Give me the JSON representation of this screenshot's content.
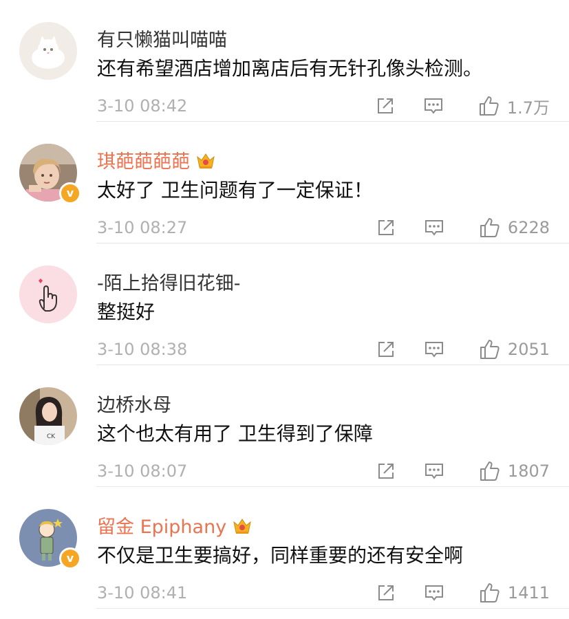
{
  "colors": {
    "vip_name": "#eb7350",
    "normal_name": "#333333",
    "time": "#b0b0b0",
    "verify_badge": "#f5a623"
  },
  "comments": [
    {
      "username": "有只懒猫叫喵喵",
      "vip": false,
      "verified": false,
      "text": "还有希望酒店增加离店后有无针孔像头检测。",
      "time": "3-10 08:42",
      "likes": "1.7万",
      "avatar_icon": "white-kitten-avatar"
    },
    {
      "username": "琪葩葩葩葩",
      "vip": true,
      "verified": true,
      "text": "太好了 卫生问题有了一定保证！",
      "time": "3-10 08:27",
      "likes": "6228",
      "avatar_icon": "child-photo-avatar"
    },
    {
      "username": "-陌上拾得旧花钿-",
      "vip": false,
      "verified": false,
      "text": "整挺好",
      "time": "3-10 08:38",
      "likes": "2051",
      "avatar_icon": "finger-heart-avatar"
    },
    {
      "username": "边桥水母",
      "vip": false,
      "verified": false,
      "text": "这个也太有用了 卫生得到了保障",
      "time": "3-10 08:07",
      "likes": "1807",
      "avatar_icon": "girl-photo-avatar"
    },
    {
      "username": "留金 Epiphany",
      "vip": true,
      "verified": true,
      "text": "不仅是卫生要搞好，同样重要的还有安全啊",
      "time": "3-10 08:41",
      "likes": "1411",
      "avatar_icon": "cartoon-kid-avatar"
    }
  ]
}
